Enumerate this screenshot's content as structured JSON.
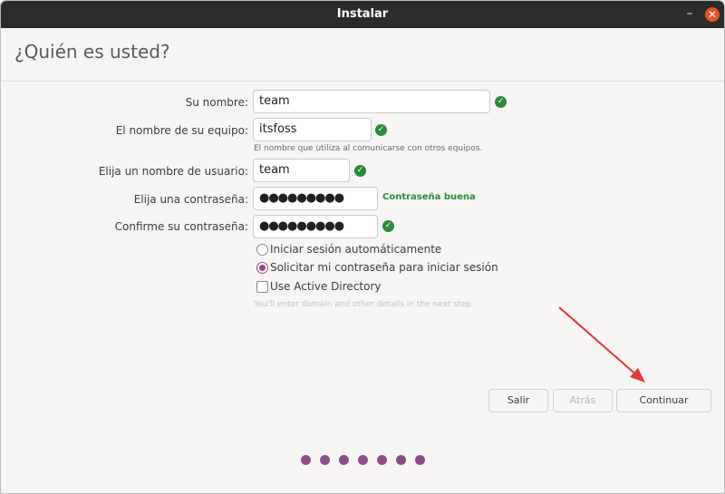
{
  "window": {
    "title": "Instalar",
    "minimize_icon": "minimize-icon",
    "close_icon": "close-icon"
  },
  "page": {
    "heading": "¿Quién es usted?"
  },
  "form": {
    "name": {
      "label": "Su nombre:",
      "value": "team"
    },
    "computer": {
      "label": "El nombre de su equipo:",
      "value": "itsfoss",
      "hint": "El nombre que utiliza al comunicarse con otros equipos."
    },
    "username": {
      "label": "Elija un nombre de usuario:",
      "value": "team"
    },
    "password": {
      "label": "Elija una contraseña:",
      "value": "●●●●●●●●●",
      "strength": "Contraseña buena"
    },
    "confirm": {
      "label": "Confirme su contraseña:",
      "value": "●●●●●●●●●"
    },
    "login_options": [
      {
        "label": "Iniciar sesión automáticamente",
        "selected": false
      },
      {
        "label": "Solicitar mi contraseña para iniciar sesión",
        "selected": true
      }
    ],
    "active_directory": {
      "label": "Use Active Directory",
      "checked": false,
      "hint": "You'll enter domain and other details in the next step."
    }
  },
  "buttons": {
    "quit": "Salir",
    "back": "Atrás",
    "continue": "Continuar"
  },
  "progress": {
    "steps": 7
  },
  "colors": {
    "accent": "#924d8b",
    "ok": "#2a8b3a",
    "titlebar": "#2c2c2c",
    "close": "#e95420",
    "annotation_arrow": "#e53935"
  }
}
